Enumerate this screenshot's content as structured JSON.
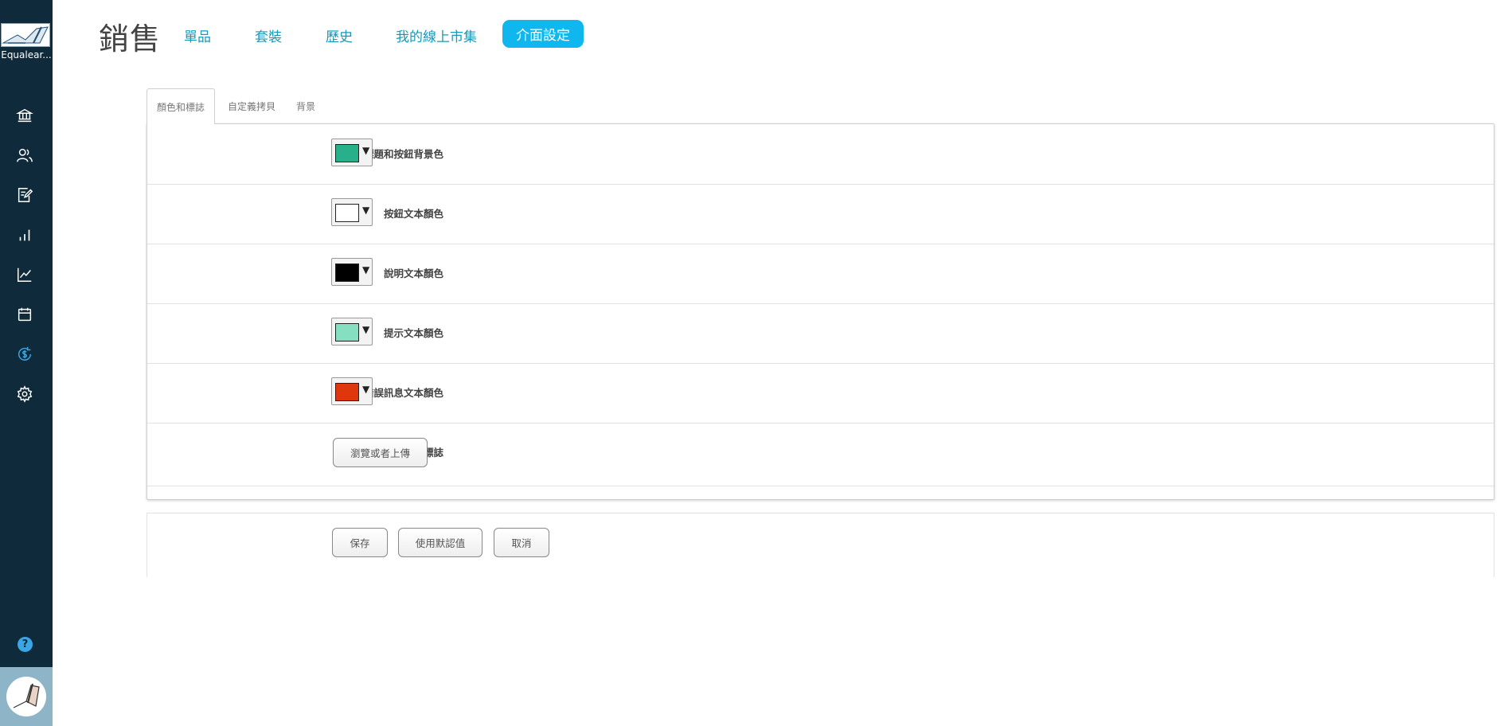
{
  "sidebar": {
    "app_name": "Equalear...",
    "icons": [
      "bank-icon",
      "users-icon",
      "edit-document-icon",
      "bar-chart-icon",
      "line-chart-icon",
      "calendar-icon",
      "dollar-cycle-icon",
      "gear-icon"
    ],
    "active_icon": "dollar-cycle-icon",
    "help_label": "?"
  },
  "header": {
    "title": "銷售",
    "nav": [
      "單品",
      "套裝",
      "歷史",
      "我的線上市集"
    ],
    "active_nav": "介面設定"
  },
  "tabs": [
    "顏色和標誌",
    "自定義拷貝",
    "背景"
  ],
  "active_tab": "顏色和標誌",
  "settings": {
    "rows": [
      {
        "label": "主標題和按鈕背景色",
        "color": "#27b08a"
      },
      {
        "label": "按鈕文本顏色",
        "color": "#ffffff"
      },
      {
        "label": "說明文本顏色",
        "color": "#000000"
      },
      {
        "label": "提示文本顏色",
        "color": "#86dfc0"
      },
      {
        "label": "錯誤訊息文本顏色",
        "color": "#e0360c"
      }
    ],
    "logo_label": "發布標誌",
    "upload_button": "瀏覽或者上傳"
  },
  "dropdown_arrow": "▼",
  "actions": {
    "save": "保存",
    "use_default": "使用默認值",
    "cancel": "取消"
  },
  "colors": {
    "sidebar_bg": "#0f2a3b",
    "accent": "#0fb7ee",
    "nav_link": "#1a98b8"
  }
}
